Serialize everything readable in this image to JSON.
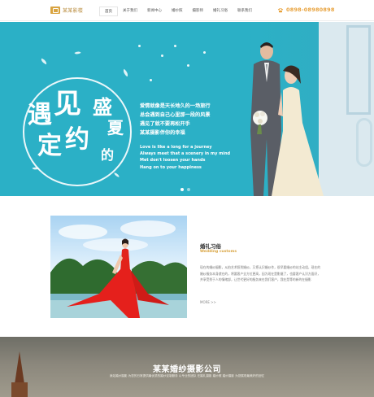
{
  "header": {
    "logo_text": "某某影楼",
    "nav": [
      "首页",
      "关于我们",
      "新闻中心",
      "婚纱照",
      "摄影师",
      "婚礼习俗",
      "联系我们"
    ],
    "phone": "0898-08980898"
  },
  "hero": {
    "big_title_chars": [
      "遇",
      "见",
      "盛",
      "夏",
      "定",
      "约",
      "的"
    ],
    "cn_lines": [
      "爱情就像是天长地久的一场旅行",
      "总会遇到自己心里那一段的风景",
      "遇见了就不要再松开手",
      "某某摄影伴你的幸福"
    ],
    "en_lines": [
      "Love is like a long for a journey",
      "Always meet that a scenery in my mind",
      "Met don't loosen your hands",
      "Hang on to your happiness"
    ],
    "slides": 2,
    "active_slide": 1
  },
  "intro": {
    "title": "婚礼习俗",
    "subtitle": "Wedding customs",
    "body": "现在的婚纱摄影，从拍艺术照到婚纱，又把认识婚纱作，很早要婚纱的站主动组，现在的婚纱服务本身就在的，将要客户全方位更高，因为现在是影摄了，也要客户认识方面好，并享受到于人的情绪部，让世代更好的服务来在我们客户，我在是等的新的在摄影",
    "more_label": "MORE >>"
  },
  "bottom": {
    "title": "某某婚纱摄影公司",
    "desc": "我站婚纱摄影 为您的日常提供最优质的婚纱定制服务 以专业的团队 在婚礼摄影 婚纱照 婚纱摄影 为您展现最美好的回忆"
  },
  "colors": {
    "accent": "#d9a441",
    "hero_bg": "#2bb0c6",
    "phone": "#e8a13a"
  }
}
